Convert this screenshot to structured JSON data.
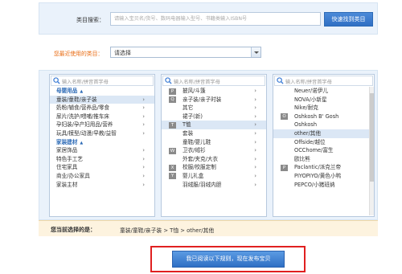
{
  "search": {
    "label": "类目搜索：",
    "placeholder": "请输入宝贝名/货号、数码电器输入型号、书籍类输入ISBN号",
    "button_label": "快速找到类目"
  },
  "recent": {
    "label": "您最近使用的类目：",
    "selected": "请选择"
  },
  "columns": {
    "search_placeholder": "输入名称/拼音首字母",
    "col1": [
      {
        "label": "母婴用品",
        "header": true,
        "arrow": "▲"
      },
      {
        "label": "童装/童鞋/亲子装",
        "selected": true
      },
      {
        "label": "奶粉/辅食/营养品/零食"
      },
      {
        "label": "尿片/洗护/喂哺/推车床"
      },
      {
        "label": "孕妇装/孕产妇用品/营养"
      },
      {
        "label": "玩具/模型/动漫/早教/益智"
      },
      {
        "label": "家装建材",
        "header": true,
        "arrow": "▲"
      },
      {
        "label": "家居饰品"
      },
      {
        "label": "特色手工艺"
      },
      {
        "label": "住宅家具"
      },
      {
        "label": "商业/办公家具"
      },
      {
        "label": "家装主材"
      }
    ],
    "col2": [
      {
        "label": "披风/斗篷",
        "letter": "P"
      },
      {
        "label": "亲子装/亲子时装",
        "letter": "Q"
      },
      {
        "label": "其它"
      },
      {
        "label": "裙子(新)"
      },
      {
        "label": "T恤",
        "letter": "T",
        "selected": true
      },
      {
        "label": "套装"
      },
      {
        "label": "童鞋/婴儿鞋"
      },
      {
        "label": "卫衣/绒衫",
        "letter": "W"
      },
      {
        "label": "外套/夹克/大衣"
      },
      {
        "label": "校服/校服定制",
        "letter": "X"
      },
      {
        "label": "婴儿礼盒",
        "letter": "Y"
      },
      {
        "label": "羽绒服/羽绒内胆"
      }
    ],
    "col3": [
      {
        "label": "Neuer/诺伊儿"
      },
      {
        "label": "NOVA/小新星"
      },
      {
        "label": "Nike/耐克"
      },
      {
        "label": "Oshkosh B' Gosh",
        "letter": "O"
      },
      {
        "label": "Oshkosh"
      },
      {
        "label": "other/其他",
        "selected": true
      },
      {
        "label": "Offside/越位"
      },
      {
        "label": "OCChome/富生"
      },
      {
        "label": "欧比熊"
      },
      {
        "label": "Paclantic/派克兰帝",
        "letter": "P"
      },
      {
        "label": "PIYOPIYO/黄色小鸭"
      },
      {
        "label": "PEPCO/小猪班纳"
      }
    ]
  },
  "selected_path": {
    "label": "您当前选择的是：",
    "value": "童装/童鞋/亲子装 > T恤 > other/其他"
  },
  "publish": {
    "button_label": "我已阅读以下规则，现在发布宝贝"
  }
}
